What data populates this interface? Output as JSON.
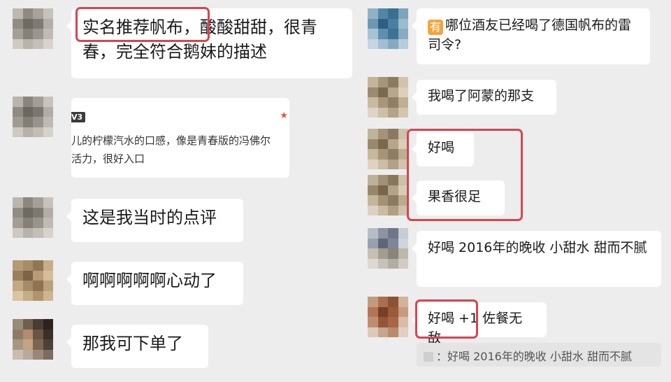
{
  "left_chat": {
    "messages": [
      {
        "type": "text",
        "text": "实名推荐帆布，酸酸甜甜，很青春，完全符合鹅妹的描述",
        "highlight": "实名推荐帆布，"
      },
      {
        "type": "card",
        "tag": "V3",
        "line1": "儿的柠檬汽水的口感，像是青春版的冯佛尔",
        "line2": "活力，很好入口"
      },
      {
        "type": "text",
        "text": "这是我当时的点评"
      },
      {
        "type": "text",
        "text": "啊啊啊啊啊心动了"
      },
      {
        "type": "text",
        "text": "那我可下单了"
      }
    ]
  },
  "right_chat": {
    "messages": [
      {
        "type": "text",
        "emoji": "有",
        "text": "哪位酒友已经喝了德国帆布的雷司令?"
      },
      {
        "type": "text",
        "text": "我喝了阿蒙的那支"
      },
      {
        "type": "text",
        "text": "好喝"
      },
      {
        "type": "text",
        "text": "果香很足"
      },
      {
        "type": "text",
        "text": "好喝 2016年的晚收 小甜水 甜而不腻"
      },
      {
        "type": "text",
        "text": "好喝 +1 佐餐无敌"
      }
    ],
    "quote": {
      "text": "：好喝 2016年的晚收 小甜水 甜而不腻"
    }
  },
  "colors": {
    "background": "#ededed",
    "bubble": "#ffffff",
    "highlight_box": "#d6454f"
  }
}
